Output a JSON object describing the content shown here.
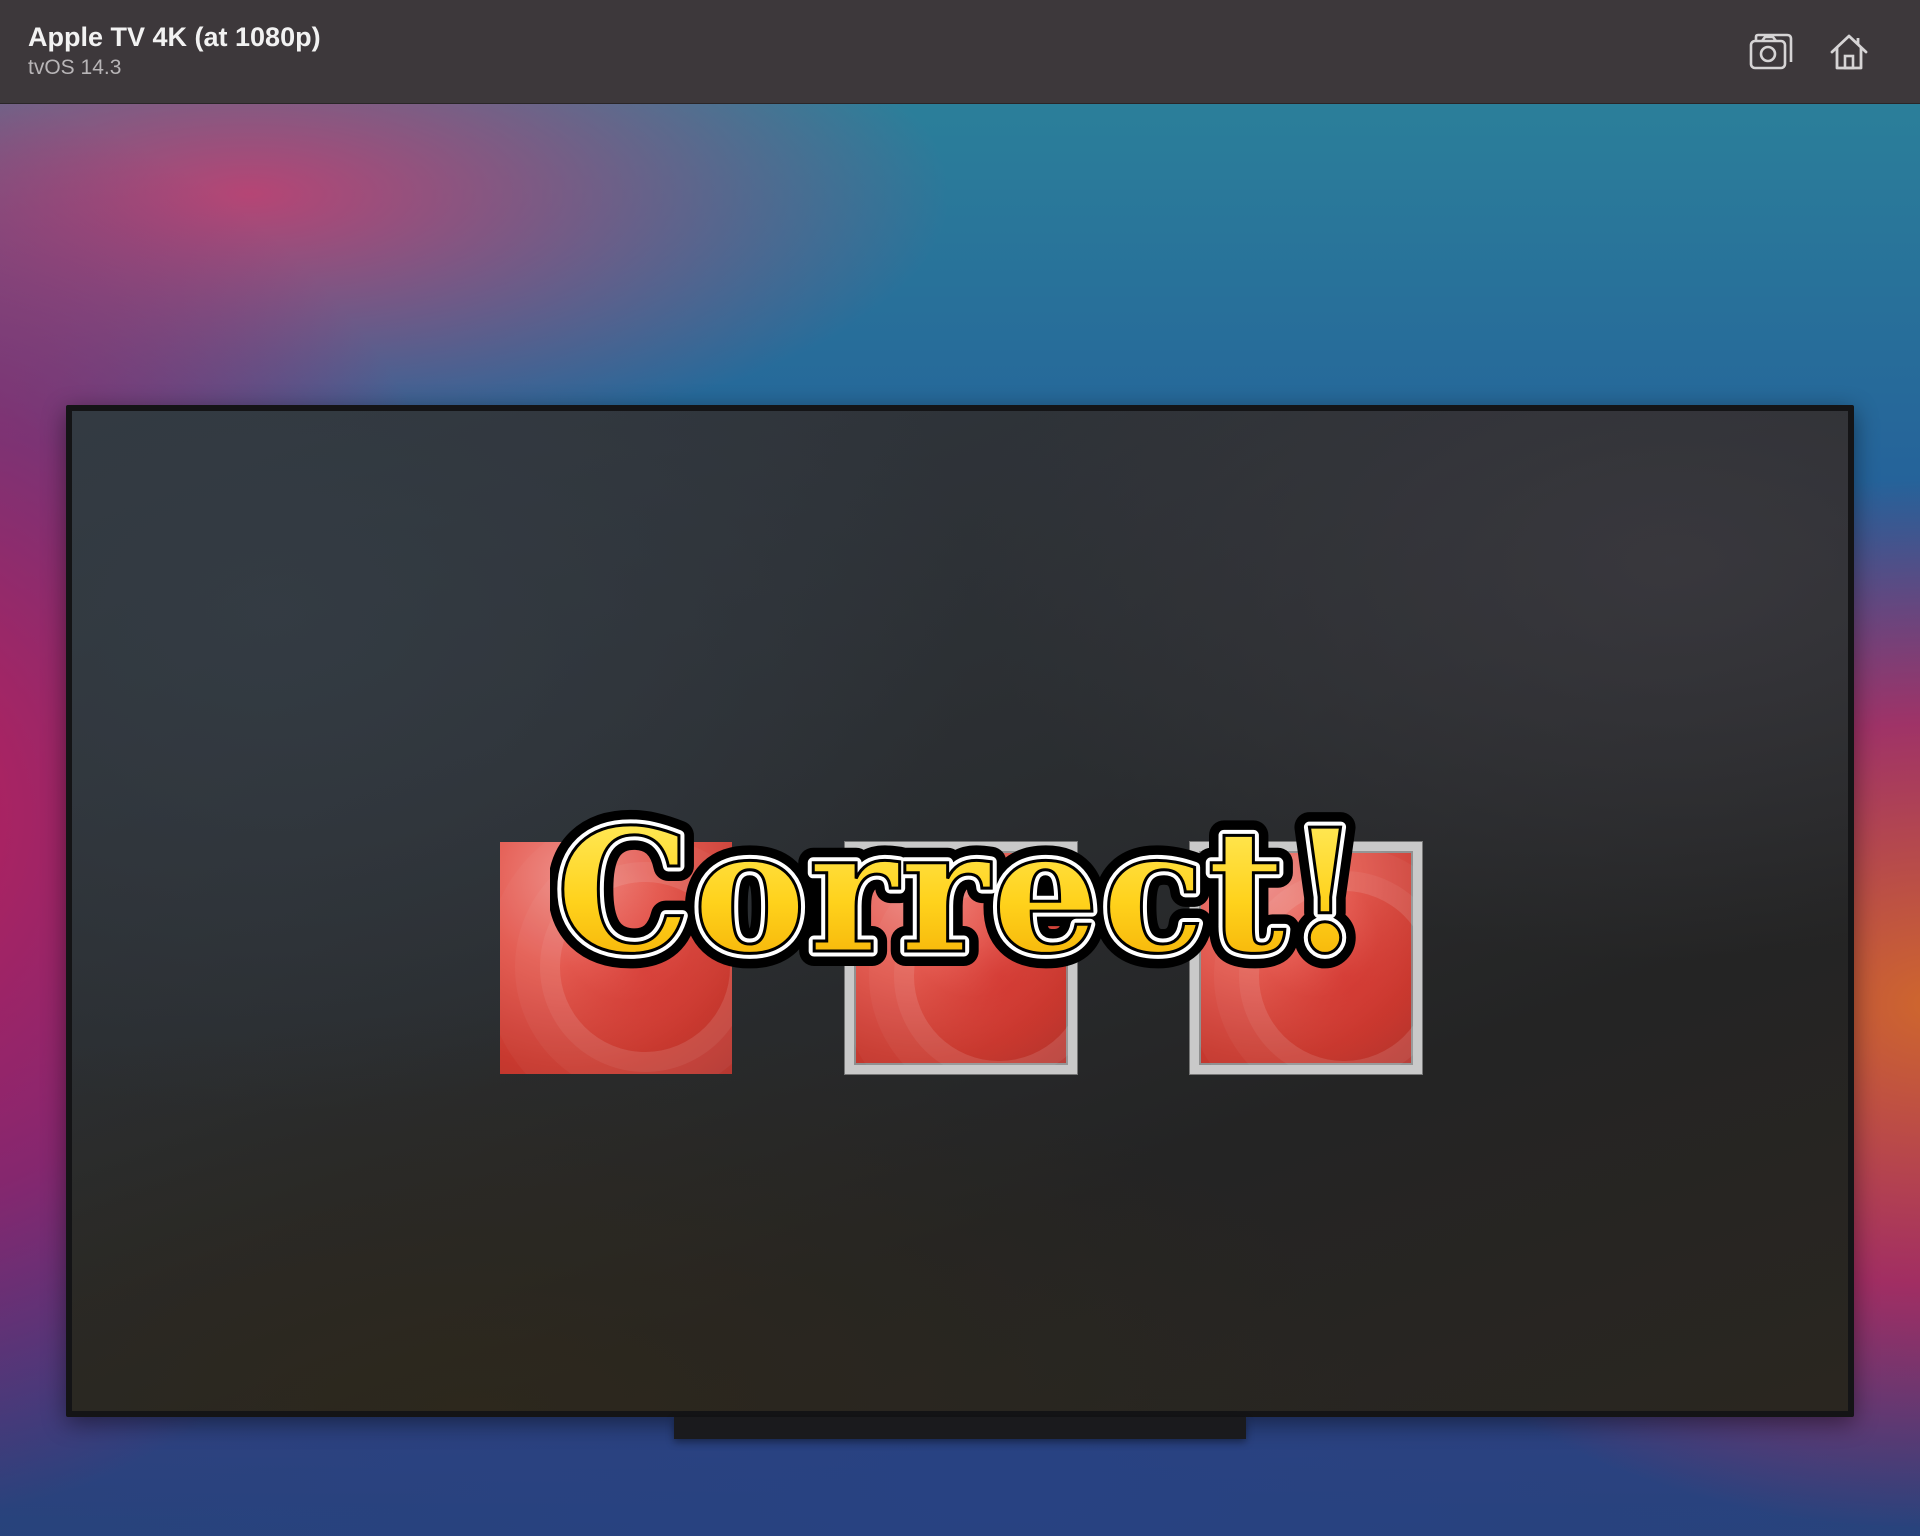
{
  "simulator": {
    "device_name": "Apple TV 4K (at 1080p)",
    "os_version": "tvOS 14.3",
    "toolbar": {
      "screenshot_icon": "camera-icon",
      "home_icon": "home-icon"
    }
  },
  "game": {
    "tiles": [
      {
        "label": "",
        "color": "#e0473d",
        "selected": false
      },
      {
        "label": "",
        "color": "#e0473d",
        "selected": true
      },
      {
        "label": "",
        "color": "#e0473d",
        "selected": true
      }
    ],
    "result_message": "Correct!",
    "result_colors": {
      "fill_top": "#fff06a",
      "fill_bottom": "#f2a800",
      "outline": "#000000"
    }
  }
}
